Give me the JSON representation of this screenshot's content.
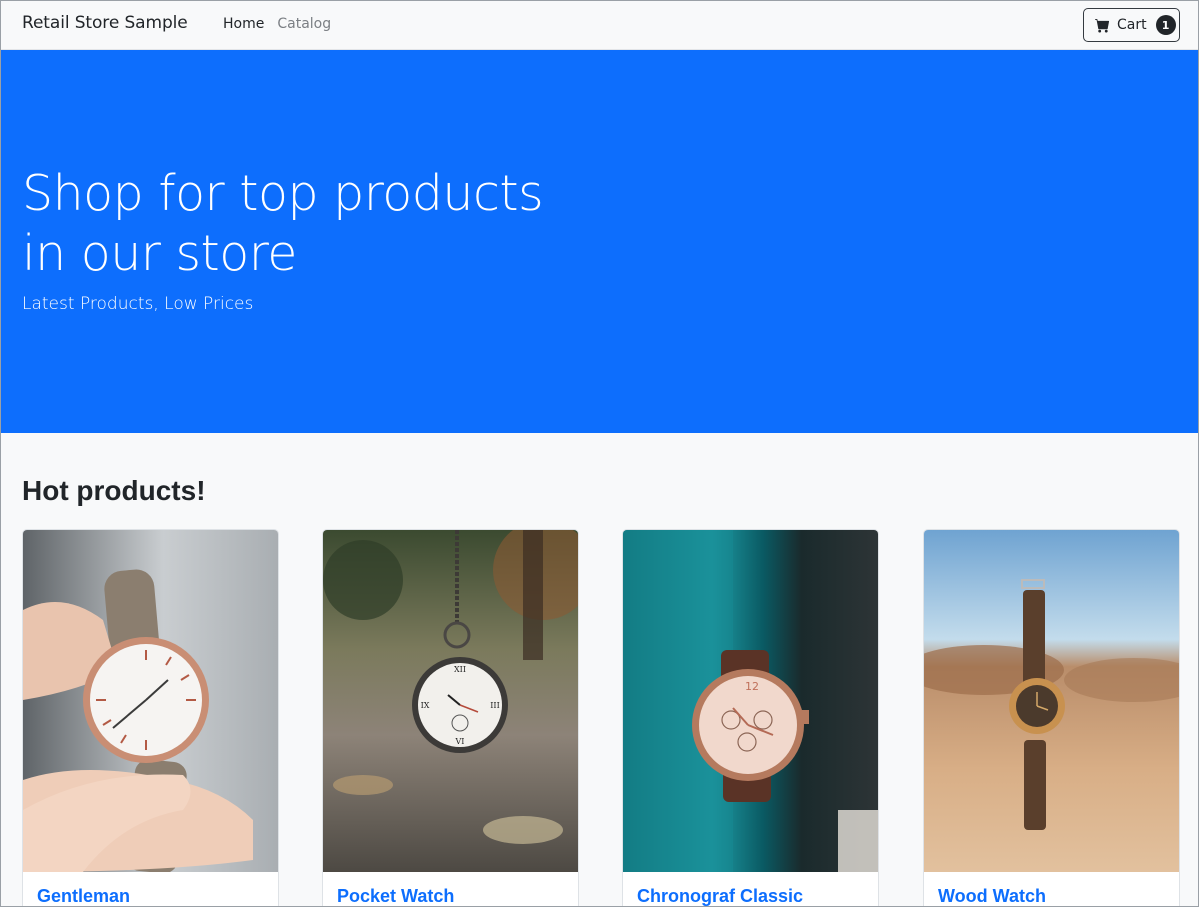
{
  "navbar": {
    "brand": "Retail Store Sample",
    "links": [
      {
        "label": "Home",
        "active": true
      },
      {
        "label": "Catalog",
        "active": false
      }
    ],
    "cart": {
      "label": "Cart",
      "count": "1",
      "icon": "cart-icon"
    }
  },
  "hero": {
    "title_line1": "Shop for top products",
    "title_line2": "in our store",
    "subtitle": "Latest Products, Low Prices",
    "background": "#0d6efd"
  },
  "section": {
    "title": "Hot products!"
  },
  "products": [
    {
      "name": "Gentleman"
    },
    {
      "name": "Pocket Watch"
    },
    {
      "name": "Chronograf Classic"
    },
    {
      "name": "Wood Watch"
    }
  ],
  "colors": {
    "accent": "#0d6efd",
    "dark": "#212529"
  }
}
